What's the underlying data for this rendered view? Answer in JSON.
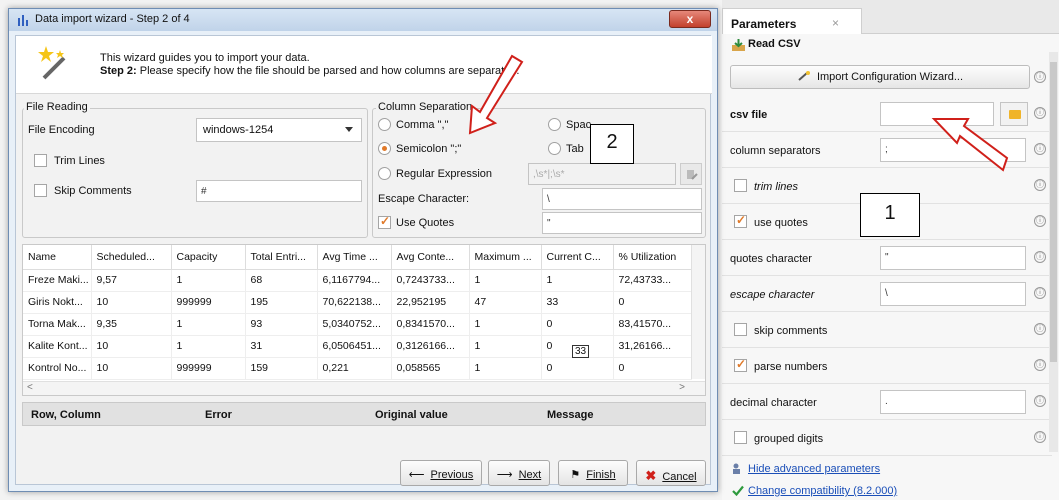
{
  "params_panel": {
    "tab_title": "Parameters",
    "tab_close": "×",
    "operator_name": "Read CSV",
    "wizard_button": "Import Configuration Wizard...",
    "rows": [
      {
        "label": "csv file",
        "value": ""
      },
      {
        "label": "column separators",
        "value": ";"
      },
      {
        "label": "trim lines",
        "checked": false
      },
      {
        "label": "use quotes",
        "checked": true
      },
      {
        "label": "quotes character",
        "value": "\""
      },
      {
        "label": "escape character",
        "value": "\\"
      },
      {
        "label": "skip comments",
        "checked": false
      },
      {
        "label": "parse numbers",
        "checked": true
      },
      {
        "label": "decimal character",
        "value": "."
      },
      {
        "label": "grouped digits",
        "checked": false
      }
    ],
    "hide_advanced": "Hide advanced parameters",
    "change_compat": "Change compatibility (8.2.000)",
    "info_glyph": "ⓘ"
  },
  "wizard": {
    "title": "Data import wizard - Step 2 of 4",
    "close": "x",
    "intro_line1": "This wizard guides you to import your data.",
    "intro_step": "Step 2:",
    "intro_line2": "Please specify how the file should be parsed and how columns are separated.",
    "file_reading": {
      "title": "File Reading",
      "encoding_label": "File Encoding",
      "encoding_value": "windows-1254",
      "trim_lines": "Trim Lines",
      "skip_comments": "Skip Comments",
      "comment_char": "#"
    },
    "column_separation": {
      "title": "Column Separation",
      "comma": "Comma \",\"",
      "semicolon": "Semicolon \";\"",
      "space": "Spac",
      "tab": "Tab",
      "regex": "Regular Expression",
      "regex_value": ",\\s*|;\\s*",
      "escape_label": "Escape Character:",
      "escape_value": "\\",
      "use_quotes": "Use Quotes",
      "quote_value": "\""
    },
    "table": {
      "headers": [
        "Name",
        "Scheduled...",
        "Capacity",
        "Total Entri...",
        "Avg Time ...",
        "Avg Conte...",
        "Maximum ...",
        "Current C...",
        "% Utilization"
      ],
      "rows": [
        [
          "Freze Maki...",
          "9,57",
          "1",
          "68",
          "6,1167794...",
          "0,7243733...",
          "1",
          "1",
          "72,43733..."
        ],
        [
          "Giris Nokt...",
          "10",
          "999999",
          "195",
          "70,622138...",
          "22,952195",
          "47",
          "33",
          "0"
        ],
        [
          "Torna Mak...",
          "9,35",
          "1",
          "93",
          "5,0340752...",
          "0,8341570...",
          "1",
          "0",
          "83,41570..."
        ],
        [
          "Kalite Kont...",
          "10",
          "1",
          "31",
          "6,0506451...",
          "0,3126166...",
          "1",
          "0",
          "31,26166..."
        ],
        [
          "Kontrol No...",
          "10",
          "999999",
          "159",
          "0,221",
          "0,058565",
          "1",
          "0",
          "0"
        ]
      ],
      "tooltip": "33",
      "scroll_left": "<",
      "scroll_right": ">"
    },
    "errors": {
      "c1": "Row, Column",
      "c2": "Error",
      "c3": "Original value",
      "c4": "Message"
    },
    "buttons": {
      "previous": "Previous",
      "next": "Next",
      "finish": "Finish",
      "cancel": "Cancel"
    }
  },
  "annotations": {
    "note1": "1",
    "note2": "2"
  },
  "colors": {
    "arrow": "#d0201a",
    "accent": "#e07a2a",
    "link": "#1b4fb8"
  }
}
